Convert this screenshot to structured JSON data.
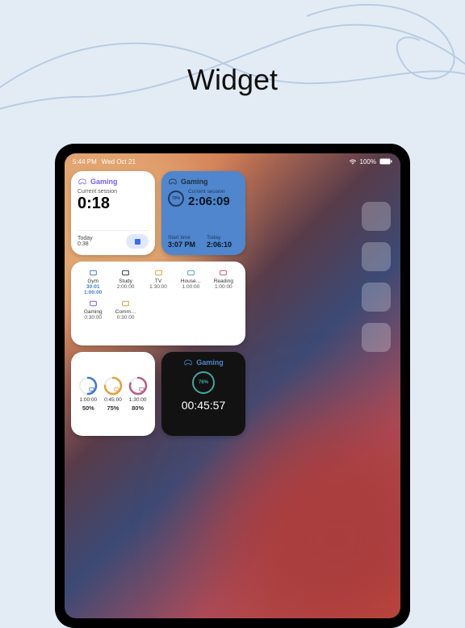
{
  "heading": "Widget",
  "statusbar": {
    "time": "5:44 PM",
    "date": "Wed Oct 21",
    "battery": "100%"
  },
  "w1": {
    "title": "Gaming",
    "sub": "Current session",
    "time": "0:18",
    "today_label": "Today",
    "today_time": "0:38"
  },
  "w2": {
    "title": "Gaming",
    "ring": "70%",
    "sub": "Current session",
    "time": "2:06:09",
    "start_label": "Start time",
    "start_val": "3:07 PM",
    "today_label": "Today",
    "today_val": "2:06:10"
  },
  "w3": {
    "row1": [
      {
        "name": "Gym",
        "t1": "30:01",
        "t2": "1:00:00",
        "color": "#3a7ad6"
      },
      {
        "name": "Study",
        "t1": "2:00:00",
        "color": "#333"
      },
      {
        "name": "TV",
        "t1": "1:30:00",
        "color": "#e8a030"
      },
      {
        "name": "House…",
        "t1": "1:00:00",
        "color": "#4aa8c0"
      },
      {
        "name": "Reading",
        "t1": "1:00:00",
        "color": "#c05a8a"
      }
    ],
    "row2": [
      {
        "name": "Gaming",
        "t1": "0:30:00",
        "color": "#7a5af5"
      },
      {
        "name": "Comm…",
        "t1": "0:30:00",
        "color": "#d8a030"
      }
    ]
  },
  "w4": {
    "items": [
      {
        "color": "#3a7ad6",
        "pct": 50,
        "time": "1:00:00",
        "pctl": "50%"
      },
      {
        "color": "#e8a030",
        "pct": 75,
        "time": "0:45:00",
        "pctl": "75%"
      },
      {
        "color": "#c05a8a",
        "pct": 80,
        "time": "1:30:00",
        "pctl": "80%"
      }
    ]
  },
  "w5": {
    "title": "Gaming",
    "ring": "76%",
    "time": "00:45:57"
  }
}
